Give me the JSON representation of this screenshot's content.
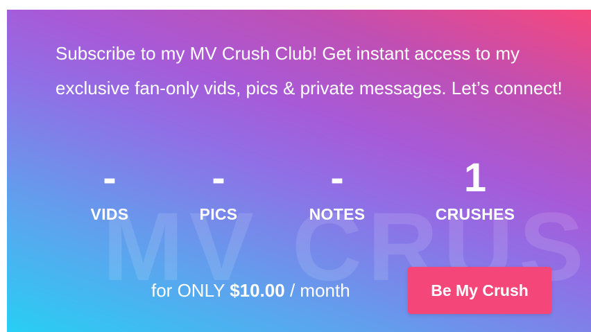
{
  "card": {
    "bio": "Subscribe to my MV Crush Club! Get instant access to my exclusive fan-only vids, pics & private messages. Let’s connect!",
    "watermark": "MV CRUSH",
    "stats": {
      "vids": {
        "value": "-",
        "label": "VIDS"
      },
      "pics": {
        "value": "-",
        "label": "PICS"
      },
      "notes": {
        "value": "-",
        "label": "NOTES"
      },
      "crushes": {
        "value": "1",
        "label": "CRUSHES"
      }
    },
    "price": {
      "prefix": "for ONLY ",
      "amount": "$10.00",
      "suffix": " / month"
    },
    "cta_label": "Be My Crush"
  }
}
